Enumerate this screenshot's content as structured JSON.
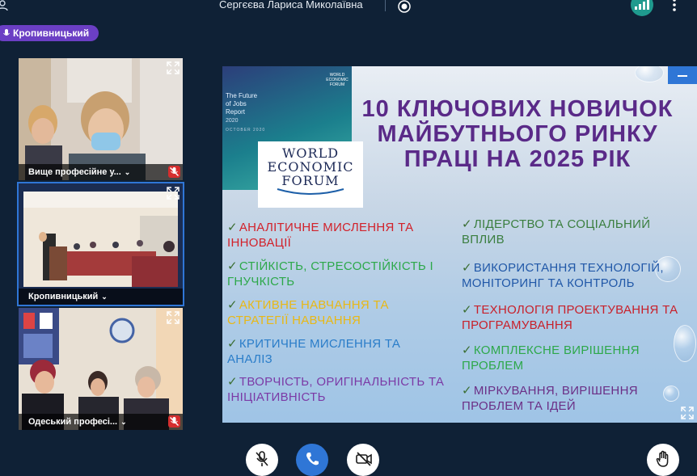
{
  "header": {
    "presenter_name": "Сергєєва Лариса Миколаївна"
  },
  "room_pill": {
    "label": "Кропивницький"
  },
  "participants": [
    {
      "label": "Вище професійне у...",
      "muted": true,
      "active": false
    },
    {
      "label": "Кропивницький",
      "muted": false,
      "active": true
    },
    {
      "label": "Одеський професі...",
      "muted": true,
      "active": false
    }
  ],
  "slide": {
    "book_title": "The Future\nof Jobs\nReport",
    "book_year": "2020",
    "book_subtitle": "OCTOBER 2020",
    "wef_small": "WORLD\nECONOMIC\nFORUM",
    "wef_logo": "WORLD\nECONOMIC\nFORUM",
    "title": "10 КЛЮЧОВИХ НОВИЧОК МАЙБУТНЬОГО РИНКУ ПРАЦІ НА 2025 РІК",
    "check": "✓",
    "skills_left": [
      {
        "text": "Аналітичне мислення та інновації",
        "color": "#d2212a"
      },
      {
        "text": "Стійкість, стресостійкість і гнучкість",
        "color": "#2da84a"
      },
      {
        "text": "Активне навчання та стратегії навчання",
        "color": "#e8b816"
      },
      {
        "text": "Критичне мислення та аналіз",
        "color": "#2a7dc9"
      },
      {
        "text": "Творчість, оригінальність та ініціативність",
        "color": "#7b3aa6"
      }
    ],
    "skills_right": [
      {
        "text": "Лідерство та соціальний вплив",
        "color": "#3a7e3f"
      },
      {
        "text": "Використання технологій, моніторинг та контроль",
        "color": "#2158a8"
      },
      {
        "text": "Технологія проектування та програмування",
        "color": "#c8202a"
      },
      {
        "text": "Комплексне вирішення проблем",
        "color": "#2da84a"
      },
      {
        "text": "Міркування, вирішення проблем та ідей",
        "color": "#6b2f86"
      }
    ]
  },
  "colors": {
    "accent_blue": "#2f76d6",
    "room_purple": "#6b3fc4",
    "signal_teal": "#1f9a8e",
    "mute_red": "#d62e2e"
  },
  "icons": {
    "user": "user-icon",
    "record": "record-icon",
    "signal": "signal-icon",
    "more": "more-vertical-icon",
    "mic_off": "mic-off-icon",
    "phone": "phone-icon",
    "camera_off": "camera-off-icon",
    "hand": "raise-hand-icon",
    "expand": "expand-icon"
  }
}
